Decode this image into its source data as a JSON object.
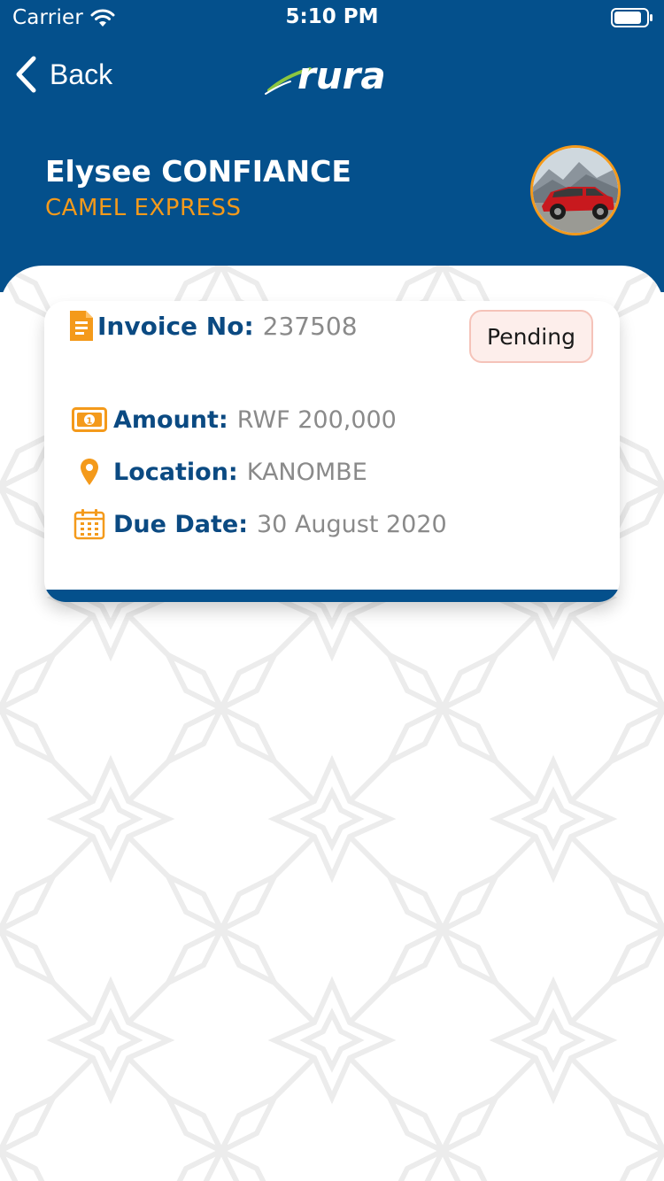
{
  "status_bar": {
    "carrier": "Carrier",
    "time": "5:10 PM"
  },
  "nav": {
    "back_label": "Back",
    "logo_text": "rura"
  },
  "profile": {
    "name": "Elysee CONFIANCE",
    "company": "CAMEL EXPRESS",
    "avatar_icon": "car-photo"
  },
  "invoice": {
    "number_label": "Invoice No:",
    "number_value": "237508",
    "status": "Pending",
    "amount_label": "Amount:",
    "amount_value": "RWF 200,000",
    "location_label": "Location:",
    "location_value": "KANOMBE",
    "due_label": "Due Date:",
    "due_value": "30 August 2020"
  },
  "colors": {
    "primary": "#04508c",
    "accent": "#f49a1b",
    "label": "#0b4a82",
    "value": "#8a8a8a",
    "badge_bg": "#fdeeeb",
    "badge_border": "#f5c3b9"
  },
  "icons": {
    "invoice": "document-icon",
    "amount": "cash-icon",
    "location": "map-pin-icon",
    "due_date": "calendar-icon"
  }
}
